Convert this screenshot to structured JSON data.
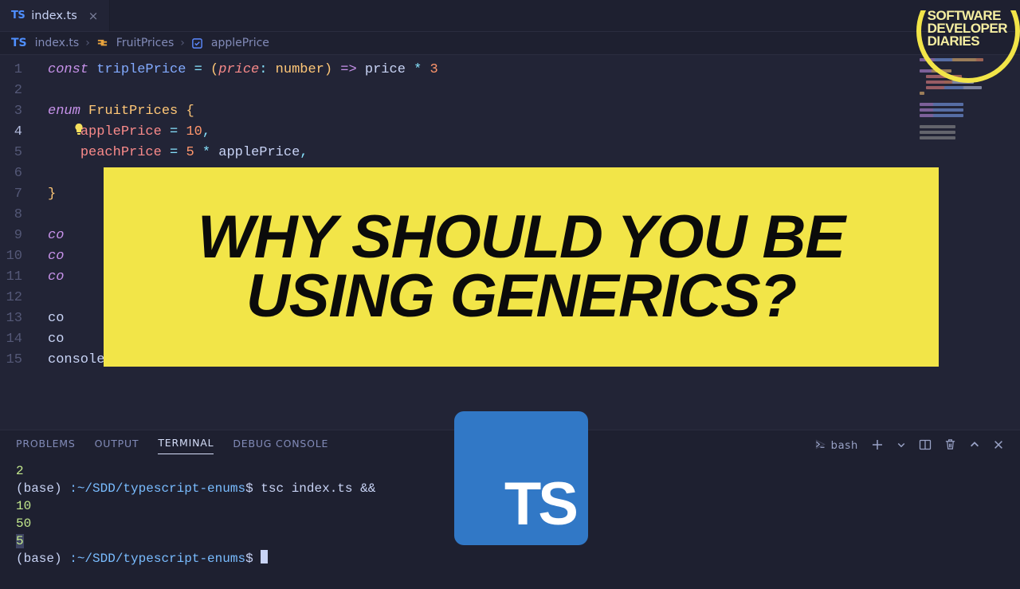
{
  "tab": {
    "filename": "index.ts",
    "badge": "TS"
  },
  "breadcrumb": {
    "file": "index.ts",
    "file_badge": "TS",
    "enum": "FruitPrices",
    "prop": "applePrice"
  },
  "line_numbers": [
    "1",
    "2",
    "3",
    "4",
    "5",
    "6",
    "7",
    "8",
    "9",
    "10",
    "11",
    "12",
    "13",
    "14",
    "15"
  ],
  "active_line_index": 3,
  "code": {
    "l1": {
      "kw": "const",
      "name": "triplePrice",
      "eq": "=",
      "paren_open": "(",
      "param": "price",
      "colon": ":",
      "type": "number",
      "paren_close": ")",
      "arrow": "=>",
      "expr_name": "price",
      "op": "*",
      "num": "3"
    },
    "l3": {
      "kw": "enum",
      "name": "FruitPrices",
      "brace": "{"
    },
    "l4": {
      "key": "applePrice",
      "eq": "=",
      "val": "10",
      "comma": ","
    },
    "l5": {
      "key": "peachPrice",
      "eq": "=",
      "five": "5",
      "op": "*",
      "ref": "applePrice",
      "comma": ","
    },
    "l7": {
      "brace": "}"
    },
    "l9": {
      "prefix": "co"
    },
    "l10": {
      "prefix": "co"
    },
    "l11": {
      "prefix": "co"
    },
    "l13": {
      "prefix": "co"
    },
    "l14": {
      "prefix": "co"
    },
    "l15": {
      "full": "console.log(fruitThree)"
    }
  },
  "panel": {
    "tabs": [
      "PROBLEMS",
      "OUTPUT",
      "TERMINAL",
      "DEBUG CONSOLE"
    ],
    "active_index": 2,
    "shell_label": "bash"
  },
  "terminal": {
    "out1": "2",
    "prompt_prefix": "(base) ",
    "prompt_path": ":~/SDD/typescript-enums",
    "prompt_suffix": "$",
    "cmd": "tsc index.ts &&",
    "out2": "10",
    "out3": "50",
    "out4": "5"
  },
  "overlay": {
    "headline": "WHY SHOULD YOU BE USING GENERICS?",
    "ts_logo": "TS",
    "channel": [
      "SOFTWARE",
      "DEVELOPER",
      "DIARIES"
    ]
  }
}
